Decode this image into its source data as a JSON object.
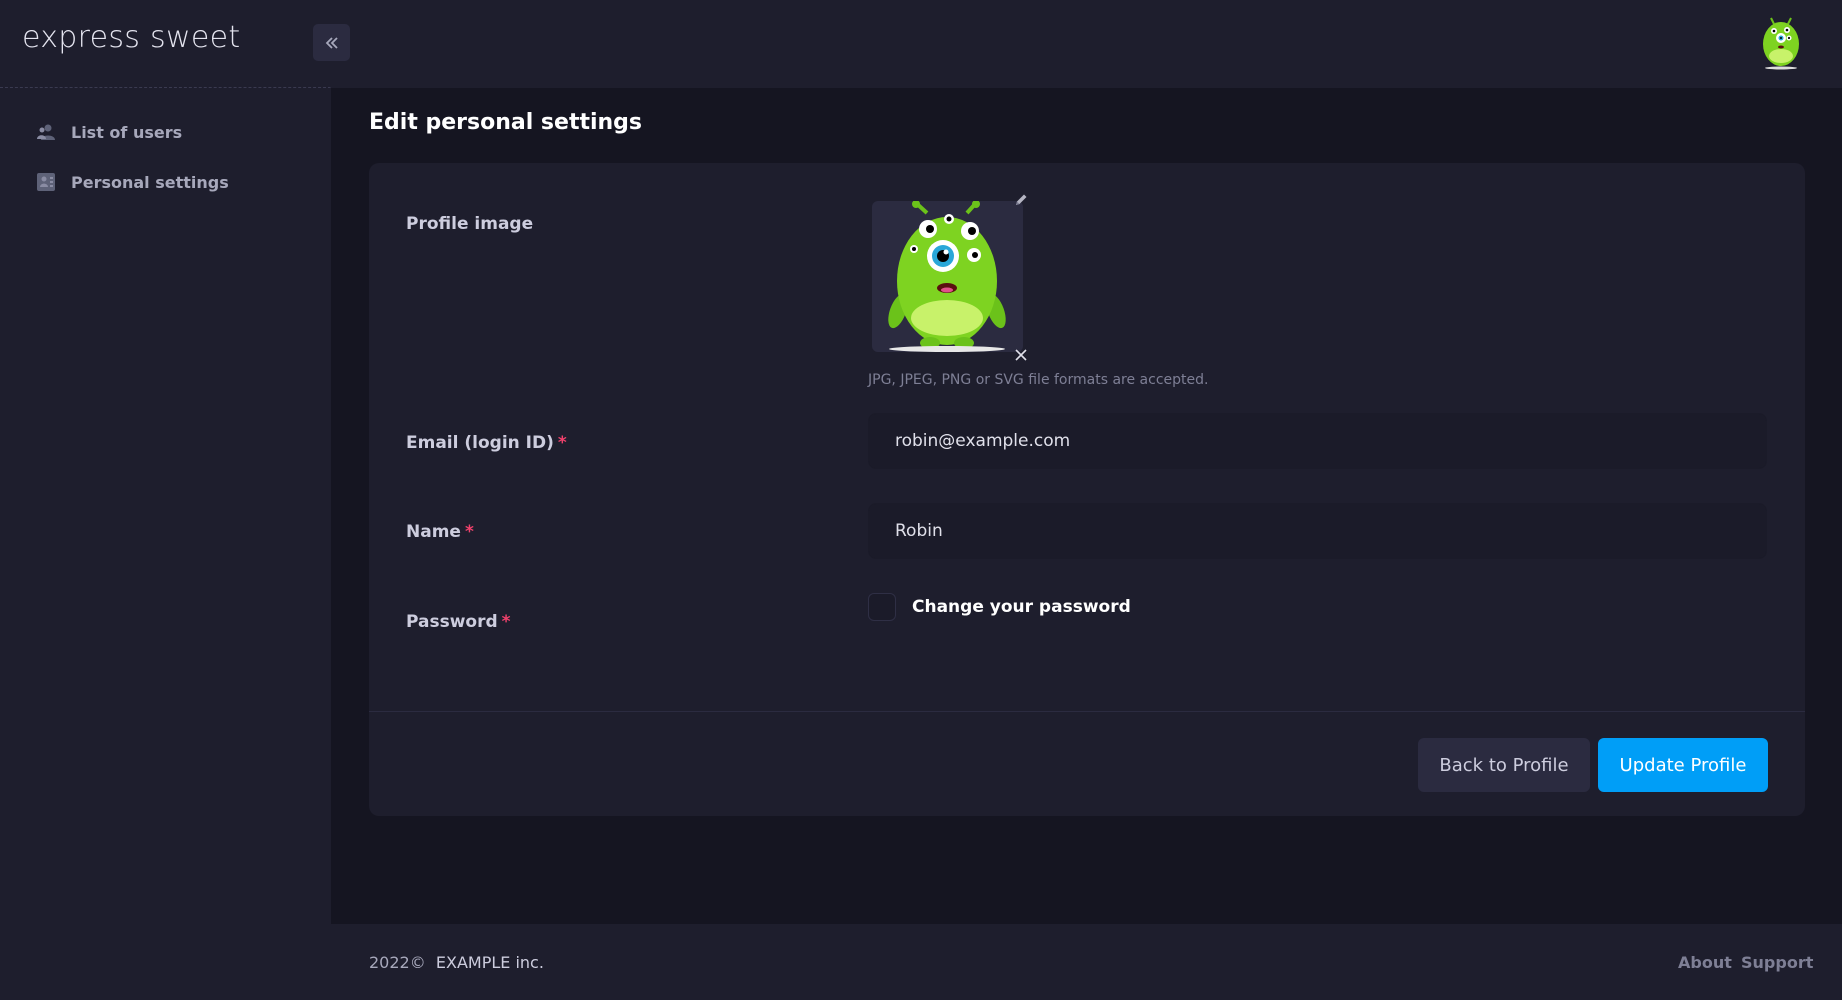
{
  "header": {
    "brand": "express sweet",
    "avatar_icon": "monster-avatar-icon"
  },
  "sidebar": {
    "items": [
      {
        "label": "List of users",
        "icon": "users-icon"
      },
      {
        "label": "Personal settings",
        "icon": "profile-card-icon"
      }
    ]
  },
  "main": {
    "title": "Edit personal settings",
    "profile_image": {
      "label": "Profile image",
      "hint": "JPG, JPEG, PNG or SVG file formats are accepted."
    },
    "email": {
      "label": "Email (login ID)",
      "required": "*",
      "value": "robin@example.com"
    },
    "name": {
      "label": "Name",
      "required": "*",
      "value": "Robin"
    },
    "password": {
      "label": "Password",
      "required": "*",
      "checkbox_label": "Change your password",
      "checked": false
    },
    "buttons": {
      "back": "Back to Profile",
      "update": "Update Profile"
    }
  },
  "footer": {
    "year": "2022©",
    "company": "EXAMPLE inc.",
    "links": [
      "About",
      "Support"
    ]
  },
  "colors": {
    "accent": "#009ef7",
    "required": "#f1416c",
    "background": "#151521",
    "panel": "#1e1e2d"
  }
}
